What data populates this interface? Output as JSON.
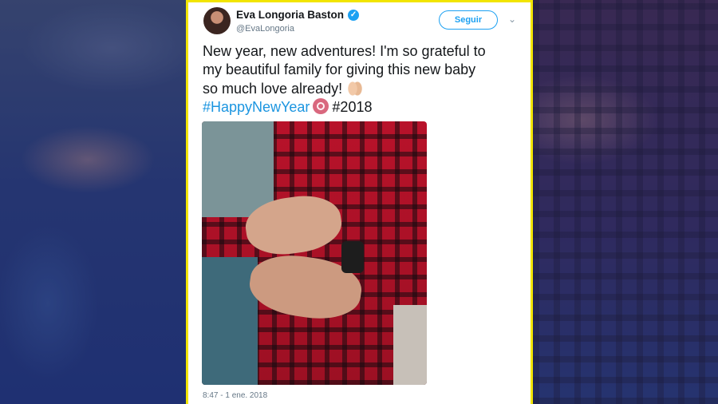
{
  "tweet": {
    "display_name": "Eva Longoria Baston",
    "handle": "@EvaLongoria",
    "follow_label": "Seguir",
    "text_lines": [
      "New year, new adventures! I'm so grateful to",
      "my beautiful family for giving this new baby",
      "so much love already! "
    ],
    "hashtag": "#HappyNewYear",
    "year_tag": "#2018",
    "timestamp": "8:47 - 1 ene. 2018"
  },
  "icons": {
    "verified": "verified-badge-icon",
    "caret": "chevron-down-icon",
    "emoji_1": "folded-hands-emoji",
    "emoji_2": "lungs-emoji"
  },
  "colors": {
    "accent": "#1da1f2",
    "hashtag": "#1b95e0",
    "frame": "#f2e500",
    "text": "#14171a",
    "muted": "#657786"
  }
}
